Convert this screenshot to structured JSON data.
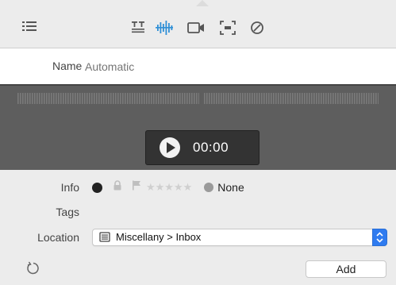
{
  "toolbar": {
    "icons": [
      "list-icon",
      "text-format-icon",
      "audio-waveform-icon",
      "video-camera-icon",
      "screen-capture-icon",
      "blocked-icon"
    ],
    "active_color": "#2f8fd6"
  },
  "name": {
    "label": "Name",
    "placeholder": "Automatic"
  },
  "player": {
    "time": "00:00"
  },
  "info": {
    "label": "Info",
    "rating_stars": "★★★★★",
    "color_label": "None",
    "rating": 0
  },
  "tags": {
    "label": "Tags"
  },
  "location": {
    "label": "Location",
    "value": "Miscellany > Inbox"
  },
  "add_button": {
    "label": "Add"
  }
}
